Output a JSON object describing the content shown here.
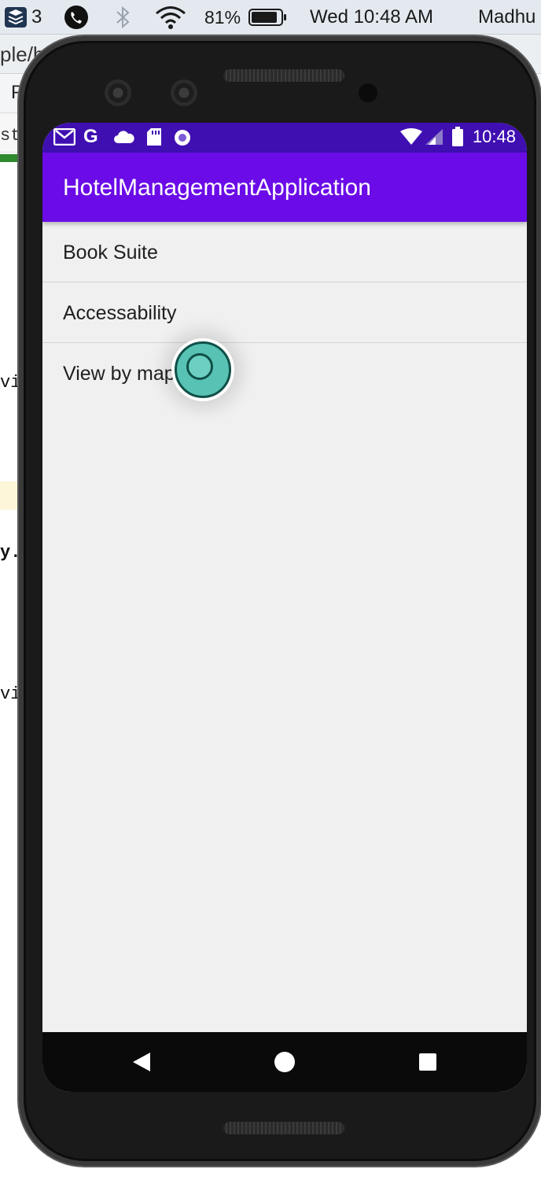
{
  "mac_menubar": {
    "layers_count": "3",
    "battery_percent": "81%",
    "datetime": "Wed 10:48 AM",
    "user": "Madhu"
  },
  "ide": {
    "tab_text": "ple/h",
    "row2_text": "P",
    "row3_text": "st",
    "code_fragments": [
      "vi",
      "y.",
      "vi"
    ]
  },
  "android": {
    "status_time": "10:48",
    "app_title": "HotelManagementApplication",
    "menu_items": [
      {
        "label": "Book Suite"
      },
      {
        "label": "Accessability"
      },
      {
        "label": "View by map"
      }
    ]
  },
  "colors": {
    "status_bar": "#3f0fb2",
    "app_bar": "#6b0ce8",
    "screen_bg": "#f0f0f0"
  },
  "icons": {
    "status_left": [
      "gmail-icon",
      "google-icon",
      "cloud-icon",
      "sd-card-icon",
      "record-icon"
    ],
    "status_right": [
      "wifi-icon",
      "cell-signal-icon",
      "battery-icon"
    ],
    "nav": [
      "back-icon",
      "home-icon",
      "recents-icon"
    ]
  }
}
